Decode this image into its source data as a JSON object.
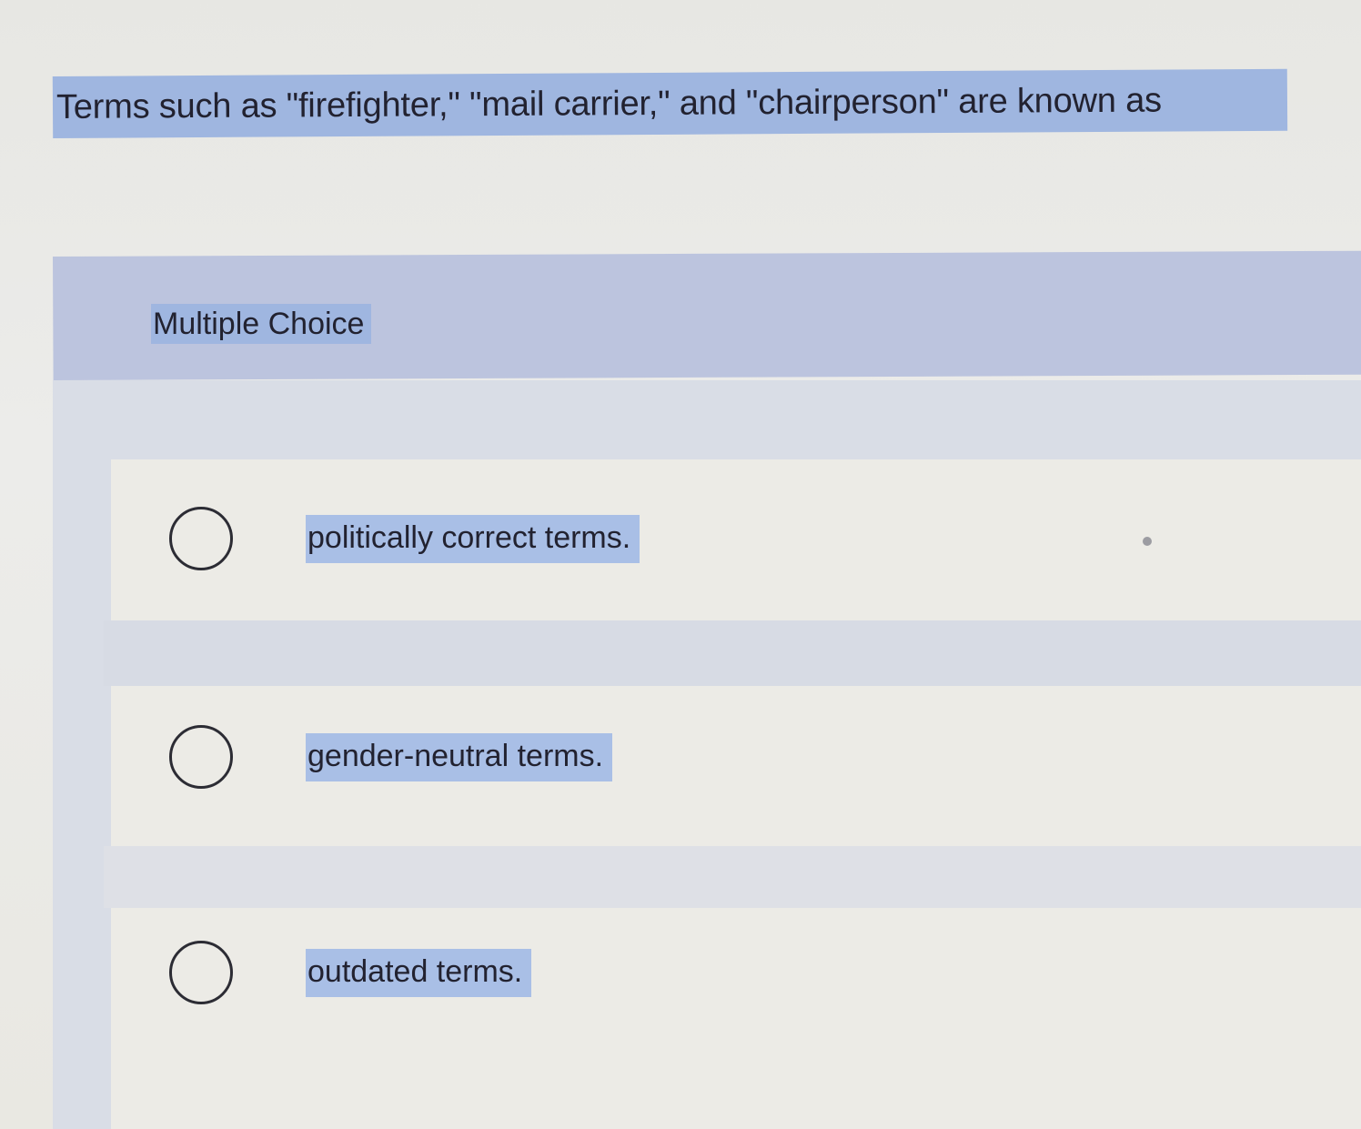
{
  "question": {
    "text": "Terms such as \"firefighter,\" \"mail carrier,\" and \"chairperson\" are known as"
  },
  "question_type": {
    "label": "Multiple Choice"
  },
  "options": [
    {
      "label": "politically correct terms.",
      "selected": false
    },
    {
      "label": "gender-neutral terms.",
      "selected": false
    },
    {
      "label": "outdated terms.",
      "selected": false
    }
  ],
  "colors": {
    "highlight": "#9fb6e0",
    "band": "#bcc4de",
    "background": "#ececea"
  }
}
